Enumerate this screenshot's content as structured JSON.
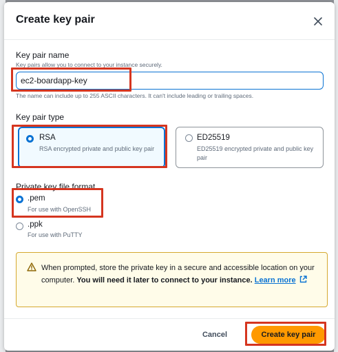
{
  "modal": {
    "title": "Create key pair"
  },
  "key_pair_name": {
    "label": "Key pair name",
    "description": "Key pairs allow you to connect to your instance securely.",
    "value": "ec2-boardapp-key",
    "constraint": "The name can include up to 255 ASCII characters. It can't include leading or trailing spaces."
  },
  "key_pair_type": {
    "label": "Key pair type",
    "options": [
      {
        "title": "RSA",
        "description": "RSA encrypted private and public key pair",
        "selected": true
      },
      {
        "title": "ED25519",
        "description": "ED25519 encrypted private and public key pair",
        "selected": false
      }
    ]
  },
  "file_format": {
    "label": "Private key file format",
    "options": [
      {
        "title": ".pem",
        "description": "For use with OpenSSH",
        "selected": true
      },
      {
        "title": ".ppk",
        "description": "For use with PuTTY",
        "selected": false
      }
    ]
  },
  "alert": {
    "text_part1": "When prompted, store the private key in a secure and accessible location on your computer.",
    "text_bold": "You will need it later to connect to your instance.",
    "link_text": "Learn more"
  },
  "footer": {
    "cancel_label": "Cancel",
    "create_label": "Create key pair"
  },
  "colors": {
    "accent": "#0972d3",
    "primary_button": "#ff9900",
    "highlight_box": "#d5351f",
    "alert_border": "#d5a82e"
  }
}
